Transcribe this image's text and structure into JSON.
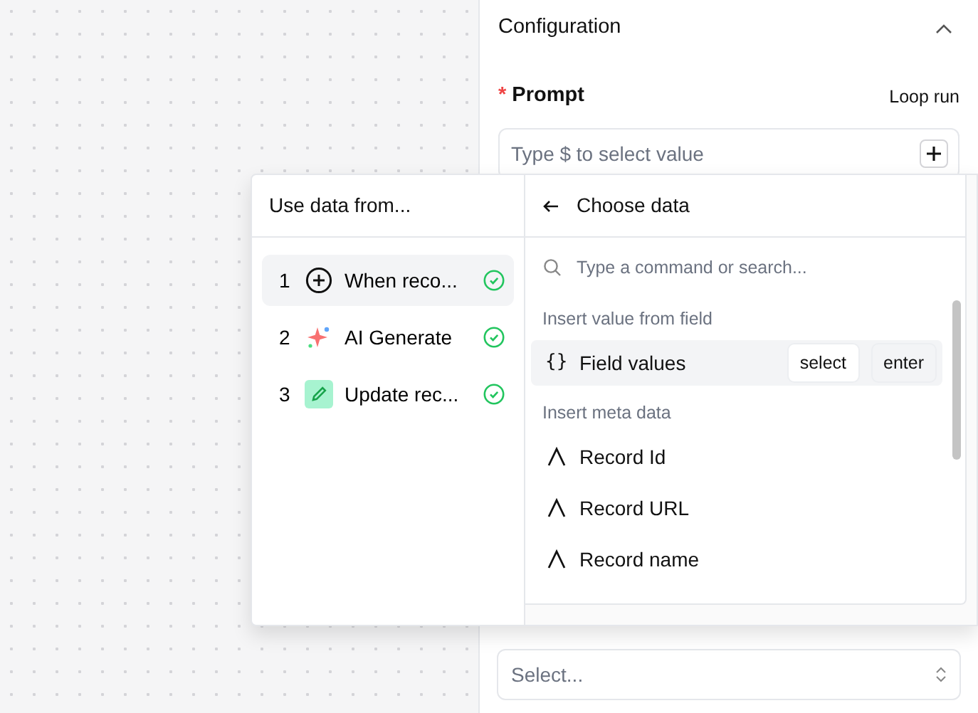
{
  "panel": {
    "title": "Configuration",
    "expanded": true,
    "prompt": {
      "label": "Prompt",
      "required_mark": "*",
      "loop_label": "Loop run",
      "placeholder": "Type $ to select value"
    },
    "output_select": {
      "placeholder": "Select..."
    }
  },
  "popup": {
    "source_title": "Use data from...",
    "steps": [
      {
        "number": "1",
        "kind": "trigger",
        "label": "When reco...",
        "done": true,
        "selected": true
      },
      {
        "number": "2",
        "kind": "ai",
        "label": "AI Generate",
        "done": true,
        "selected": false
      },
      {
        "number": "3",
        "kind": "update",
        "label": "Update rec...",
        "done": true,
        "selected": false
      }
    ],
    "data_title": "Choose data",
    "search": {
      "placeholder": "Type a command or search..."
    },
    "groups": [
      {
        "title": "Insert value from field",
        "items": [
          {
            "kind": "field",
            "glyph": "{}",
            "label": "Field values",
            "selected": true,
            "keys": [
              "select",
              "enter"
            ]
          }
        ]
      },
      {
        "title": "Insert meta data",
        "items": [
          {
            "kind": "meta",
            "label": "Record Id",
            "selected": false
          },
          {
            "kind": "meta",
            "label": "Record URL",
            "selected": false
          },
          {
            "kind": "meta",
            "label": "Record name",
            "selected": false
          }
        ]
      }
    ]
  }
}
